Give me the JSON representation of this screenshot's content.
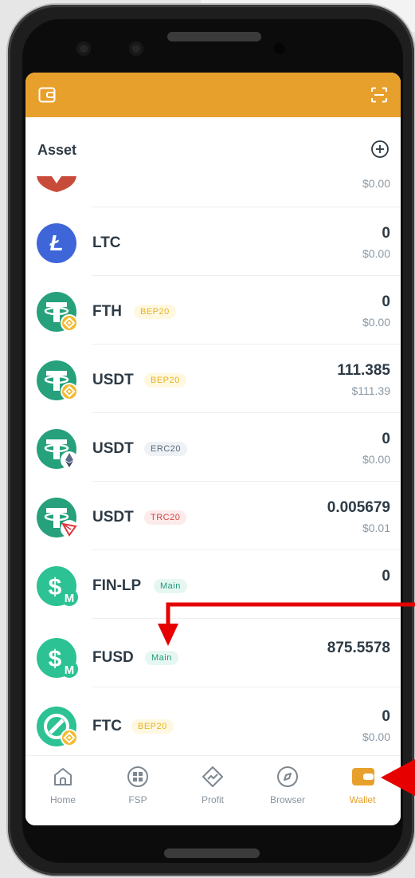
{
  "header": {
    "title": "Asset"
  },
  "assets": [
    {
      "symbol": "",
      "tag": "",
      "amount": "",
      "usd": "$0.00"
    },
    {
      "symbol": "LTC",
      "tag": "",
      "amount": "0",
      "usd": "$0.00"
    },
    {
      "symbol": "FTH",
      "tag": "BEP20",
      "amount": "0",
      "usd": "$0.00"
    },
    {
      "symbol": "USDT",
      "tag": "BEP20",
      "amount": "111.385",
      "usd": "$111.39"
    },
    {
      "symbol": "USDT",
      "tag": "ERC20",
      "amount": "0",
      "usd": "$0.00"
    },
    {
      "symbol": "USDT",
      "tag": "TRC20",
      "amount": "0.005679",
      "usd": "$0.01"
    },
    {
      "symbol": "FIN-LP",
      "tag": "Main",
      "amount": "0",
      "usd": ""
    },
    {
      "symbol": "FUSD",
      "tag": "Main",
      "amount": "875.5578",
      "usd": ""
    },
    {
      "symbol": "FTC",
      "tag": "BEP20",
      "amount": "0",
      "usd": "$0.00"
    }
  ],
  "nav": {
    "items": [
      {
        "label": "Home",
        "icon": "home-icon"
      },
      {
        "label": "FSP",
        "icon": "fsp-icon"
      },
      {
        "label": "Profit",
        "icon": "profit-icon"
      },
      {
        "label": "Browser",
        "icon": "compass-icon"
      },
      {
        "label": "Wallet",
        "icon": "wallet-icon"
      }
    ],
    "active": "Wallet"
  },
  "colors": {
    "accent": "#e8a02c",
    "ltc": "#3f66d9",
    "tether": "#26a17b",
    "fusd": "#2cc293",
    "annotation_arrow": "#e60000"
  }
}
